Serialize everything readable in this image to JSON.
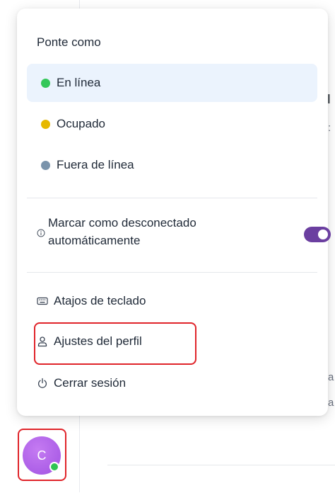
{
  "menu": {
    "heading": "Ponte como",
    "statuses": [
      {
        "label": "En línea",
        "color": "#34c759",
        "active": true
      },
      {
        "label": "Ocupado",
        "color": "#e6b800",
        "active": false
      },
      {
        "label": "Fuera de línea",
        "color": "#7a93ab",
        "active": false
      }
    ],
    "auto_offline": {
      "label": "Marcar como desconectado automáticamente",
      "enabled": true,
      "toggle_color": "#6b3fa0"
    },
    "actions": [
      {
        "label": "Atajos de teclado",
        "icon": "keyboard-icon"
      },
      {
        "label": "Ajustes del perfil",
        "icon": "user-icon"
      },
      {
        "label": "Cerrar sesión",
        "icon": "power-icon"
      }
    ]
  },
  "avatar": {
    "initial": "C",
    "presence": "online",
    "presence_color": "#2fc553"
  },
  "highlight_color": "#e0242a"
}
